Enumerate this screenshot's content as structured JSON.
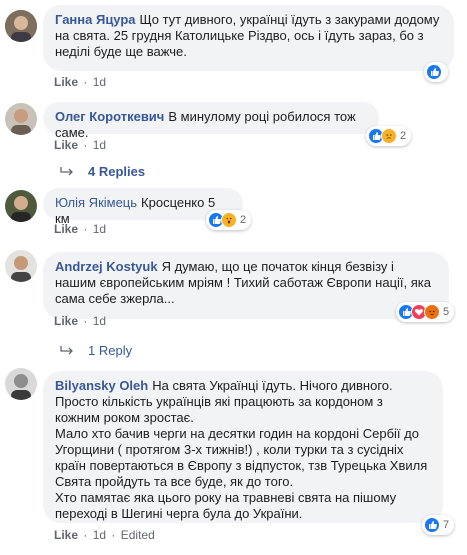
{
  "comments": [
    {
      "author": "Ганна Яцура",
      "text": "Що тут дивного, українці їдуть з закурами додому на свята. 25 грудня Католицьке Різдво, ось і їдуть зараз, бо з неділі буде ще важче.",
      "like": "Like",
      "time": "1d",
      "reaction_count": "",
      "reactions": [
        "like-icon"
      ]
    },
    {
      "author": "Олег Короткевич",
      "text": "В минулому році робилося тож саме.",
      "like": "Like",
      "time": "1d",
      "reaction_count": "2",
      "reactions": [
        "like-icon",
        "sad-icon"
      ]
    },
    {
      "author": "Юлія Якімець",
      "text": "Кросценко 5 км",
      "like": "Like",
      "time": "1d",
      "reaction_count": "2",
      "reactions": [
        "like-icon",
        "wow-icon"
      ]
    },
    {
      "author": "Andrzej Kostyuk",
      "text": "Я думаю, що це початок кінця безвізу і нашим європейським мріям ! Тихий саботаж Європи нації, яка сама себе зжерла...",
      "like": "Like",
      "time": "1d",
      "reaction_count": "5",
      "reactions": [
        "like-icon",
        "love-icon",
        "angry-icon"
      ]
    },
    {
      "author": "Bilyansky Oleh",
      "text_lines": [
        "На свята Українці їдуть. Нічого дивного.",
        "Просто кількість українців які працюють за кордоном з кожним роком зростає.",
        "Мало хто бачив черги на десятки годин на кордоні Сербії до Угорщини ( протягом 3-х тижнів!) , коли турки та з сусідніх країн повертаються в Європу з відпусток, тзв Турецька Хвиля Свята пройдуть та все буде, як до того.",
        "Хто памятає яка цього року на травневі свята на пішому переході в Шегині черга була до України."
      ],
      "like": "Like",
      "time": "1d",
      "edited": "Edited",
      "reaction_count": "7",
      "reactions": [
        "like-icon"
      ]
    }
  ],
  "reply_links": [
    "4 Replies",
    "1 Reply"
  ],
  "separator": "·",
  "colors": {
    "link": "#385898",
    "bubble": "#f2f3f5",
    "like": "#1877f2"
  }
}
